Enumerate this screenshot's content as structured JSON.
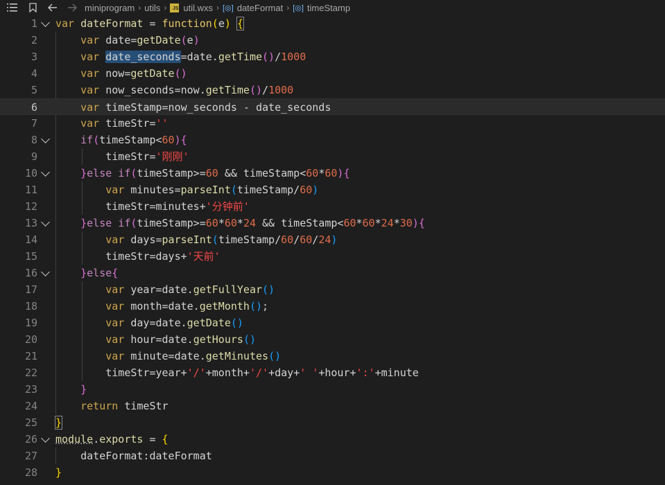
{
  "breadcrumb": {
    "items": [
      "miniprogram",
      "utils",
      "util.wxs",
      "dateFormat",
      "timeStamp"
    ],
    "file_badge": "JS"
  },
  "lines": [
    {
      "n": "1"
    },
    {
      "n": "2"
    },
    {
      "n": "3"
    },
    {
      "n": "4"
    },
    {
      "n": "5"
    },
    {
      "n": "6"
    },
    {
      "n": "7"
    },
    {
      "n": "8"
    },
    {
      "n": "9"
    },
    {
      "n": "10"
    },
    {
      "n": "11"
    },
    {
      "n": "12"
    },
    {
      "n": "13"
    },
    {
      "n": "14"
    },
    {
      "n": "15"
    },
    {
      "n": "16"
    },
    {
      "n": "17"
    },
    {
      "n": "18"
    },
    {
      "n": "19"
    },
    {
      "n": "20"
    },
    {
      "n": "21"
    },
    {
      "n": "22"
    },
    {
      "n": "23"
    },
    {
      "n": "24"
    },
    {
      "n": "25"
    },
    {
      "n": "26"
    },
    {
      "n": "27"
    },
    {
      "n": "28"
    }
  ],
  "code": {
    "l1": {
      "var": "var",
      "name": "dateFormat",
      "eq": " = ",
      "function": "function",
      "po": "(",
      "arg": "e",
      "pc": ")",
      "sp": " ",
      "brace": "{"
    },
    "l2": {
      "var": "var",
      "a": " date=",
      "fn": "getDate",
      "po": "(",
      "arg": "e",
      "pc": ")"
    },
    "l3": {
      "var": "var",
      "sel": "date_seconds",
      "a": "=date.",
      "fn": "getTime",
      "pp": "()",
      "op": "/",
      "num": "1000"
    },
    "l4": {
      "var": "var",
      "a": " now=",
      "fn": "getDate",
      "pp": "()"
    },
    "l5": {
      "var": "var",
      "a": " now_seconds=now.",
      "fn": "getTime",
      "pp": "()",
      "op": "/",
      "num": "1000"
    },
    "l6": {
      "var": "var",
      "a": " timeStamp=now_seconds - date_seconds"
    },
    "l7": {
      "var": "var",
      "a": " timeStr=",
      "str": "''"
    },
    "l8": {
      "if": "if",
      "po": "(",
      "a": "timeStamp<",
      "num": "60",
      "pc": ")",
      "brace": "{"
    },
    "l9": {
      "a": "timeStr=",
      "str": "'刚刚'"
    },
    "l10": {
      "bc": "}",
      "else": "else",
      "if": "if",
      "po": "(",
      "a": "timeStamp>=",
      "n1": "60",
      "b": " && timeStamp<",
      "n2": "60",
      "op": "*",
      "n3": "60",
      "pc": ")",
      "brace": "{"
    },
    "l11": {
      "var": "var",
      "a": " minutes=",
      "fn": "parseInt",
      "po": "(",
      "b": "timeStamp/",
      "num": "60",
      "pc": ")"
    },
    "l12": {
      "a": "timeStr=minutes+",
      "str": "'分钟前'"
    },
    "l13": {
      "bc": "}",
      "else": "else",
      "if": "if",
      "po": "(",
      "a": "timeStamp>=",
      "n1": "60",
      "o1": "*",
      "n2": "60",
      "o2": "*",
      "n3": "24",
      "b": " && timeStamp<",
      "n4": "60",
      "o3": "*",
      "n5": "60",
      "o4": "*",
      "n6": "24",
      "o5": "*",
      "n7": "30",
      "pc": ")",
      "brace": "{"
    },
    "l14": {
      "var": "var",
      "a": " days=",
      "fn": "parseInt",
      "po": "(",
      "b": "timeStamp/",
      "n1": "60",
      "o1": "/",
      "n2": "60",
      "o2": "/",
      "n3": "24",
      "pc": ")"
    },
    "l15": {
      "a": "timeStr=days+",
      "str": "'天前'"
    },
    "l16": {
      "bc": "}",
      "else": "else",
      "brace": "{"
    },
    "l17": {
      "var": "var",
      "a": " year=date.",
      "fn": "getFullYear",
      "pp": "()"
    },
    "l18": {
      "var": "var",
      "a": " month=date.",
      "fn": "getMonth",
      "pp": "()",
      "semi": ";"
    },
    "l19": {
      "var": "var",
      "a": " day=date.",
      "fn": "getDate",
      "pp": "()"
    },
    "l20": {
      "var": "var",
      "a": " hour=date.",
      "fn": "getHours",
      "pp": "()"
    },
    "l21": {
      "var": "var",
      "a": " minute=date.",
      "fn": "getMinutes",
      "pp": "()"
    },
    "l22": {
      "a": "timeStr=year+",
      "s1": "'/'",
      "b": "+month+",
      "s2": "'/'",
      "c": "+day+",
      "s3": "' '",
      "d": "+hour+",
      "s4": "':'",
      "e": "+minute"
    },
    "l23": {
      "bc": "}"
    },
    "l24": {
      "ret": "return",
      "a": " timeStr"
    },
    "l25": {
      "bc": "}"
    },
    "l26": {
      "mod": "module",
      "dot": ".",
      "exp": "exports",
      "eq": " = ",
      "brace": "{"
    },
    "l27": {
      "a": "dateFormat:dateFormat"
    },
    "l28": {
      "bc": "}"
    }
  }
}
